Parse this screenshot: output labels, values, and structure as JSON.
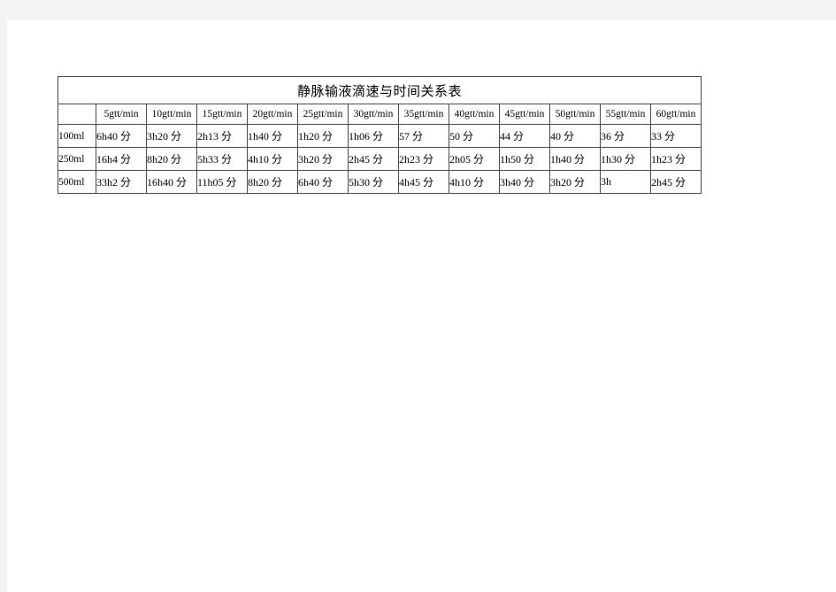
{
  "page": {
    "background_margin_color": "#f4f4f4",
    "sheet_color": "#ffffff",
    "border_color": "#4a4a4a",
    "outer_border_color": "#8a8a8a"
  },
  "table": {
    "title": "静脉输液滴速与时间关系表",
    "corner_label": "",
    "column_headers": [
      "5gtt/min",
      "10gtt/min",
      "15gtt/min",
      "20gtt/min",
      "25gtt/min",
      "30gtt/min",
      "35gtt/min",
      "40gtt/min",
      "45gtt/min",
      "50gtt/min",
      "55gtt/min",
      "60gtt/min"
    ],
    "rows": [
      {
        "label": "100ml",
        "values": [
          "6h40 分",
          "3h20 分",
          "2h13 分",
          "1h40 分",
          "1h20 分",
          "1h06 分",
          "57 分",
          "50 分",
          "44 分",
          "40 分",
          "36 分",
          "33 分"
        ]
      },
      {
        "label": "250ml",
        "values": [
          "16h4 分",
          "8h20 分",
          "5h33 分",
          "4h10 分",
          "3h20 分",
          "2h45 分",
          "2h23 分",
          "2h05 分",
          "1h50 分",
          "1h40 分",
          "1h30 分",
          "1h23 分"
        ]
      },
      {
        "label": "500ml",
        "values": [
          "33h2 分",
          "16h40 分",
          "11h05 分",
          "8h20 分",
          "6h40 分",
          "5h30 分",
          "4h45 分",
          "4h10 分",
          "3h40 分",
          "3h20 分",
          "3h",
          "2h45 分"
        ]
      }
    ]
  }
}
